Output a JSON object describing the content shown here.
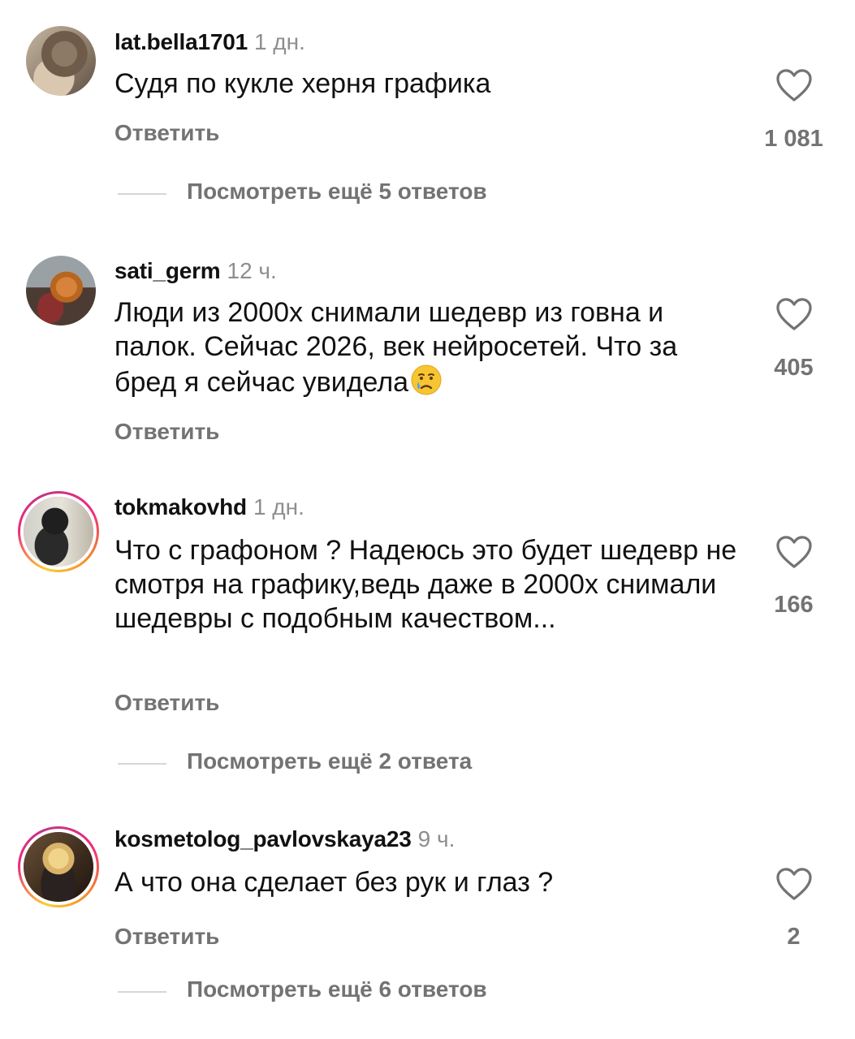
{
  "comments": [
    {
      "username": "lat.bella1701",
      "time": "1 дн.",
      "text": "Судя по кукле херня графика",
      "reply_label": "Ответить",
      "likes": "1 081",
      "view_more": "Посмотреть ещё 5 ответов"
    },
    {
      "username": "sati_germ",
      "time": "12 ч.",
      "text": "Люди из 2000х снимали шедевр из говна и палок. Сейчас 2026, век нейросетей. Что за бред я сейчас увидела",
      "emoji": "crying-face-emoji",
      "reply_label": "Ответить",
      "likes": "405"
    },
    {
      "username": "tokmakovhd",
      "time": "1 дн.",
      "text": "Что с графоном ? Надеюсь это будет шедевр не смотря на графику,ведь даже в 2000х снимали шедевры с подобным качеством...",
      "reply_label": "Ответить",
      "likes": "166",
      "view_more": "Посмотреть ещё 2 ответа"
    },
    {
      "username": "kosmetolog_pavlovskaya23",
      "time": "9 ч.",
      "text": "А что она сделает без рук и глаз ?",
      "reply_label": "Ответить",
      "likes": "2",
      "view_more": "Посмотреть ещё 6 ответов"
    }
  ],
  "icons": {
    "like": "heart-outline-icon"
  },
  "colors": {
    "text": "#111111",
    "secondary": "#737373",
    "time": "#8e8e8e",
    "divider": "#d6d6d6",
    "story_ring_start": "#f9ce34",
    "story_ring_mid": "#ee2a7b"
  }
}
